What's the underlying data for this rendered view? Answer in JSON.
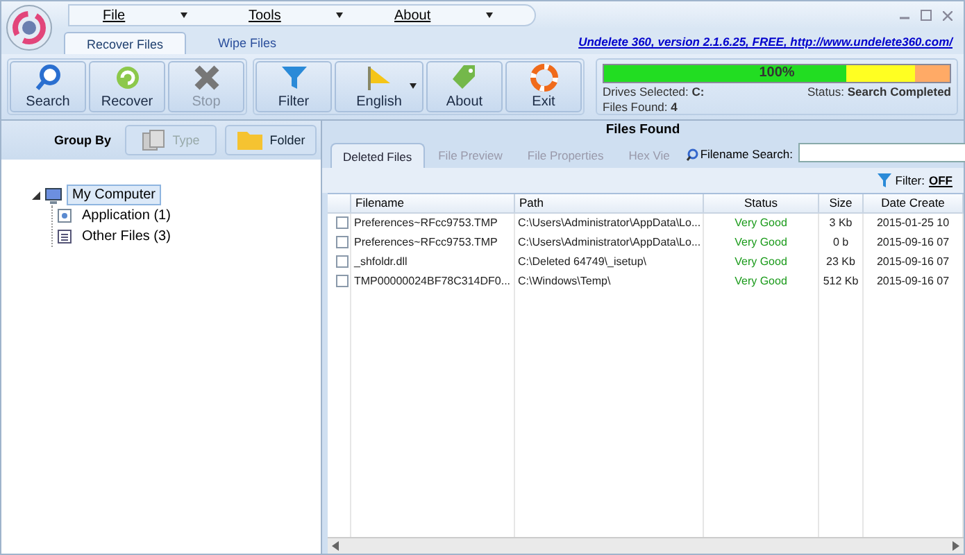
{
  "menu": [
    {
      "label": "File"
    },
    {
      "label": "Tools"
    },
    {
      "label": "About"
    }
  ],
  "ribbon_tabs": [
    {
      "label": "Recover Files",
      "selected": true
    },
    {
      "label": "Wipe Files",
      "selected": false
    }
  ],
  "version_link": "Undelete 360, version 2.1.6.25, FREE, http://www.undelete360.com/",
  "toolbar": [
    {
      "label": "Search",
      "disabled": false
    },
    {
      "label": "Recover",
      "disabled": false
    },
    {
      "label": "Stop",
      "disabled": true
    },
    {
      "label": "Filter",
      "disabled": false
    },
    {
      "label": "English",
      "disabled": false
    },
    {
      "label": "About",
      "disabled": false
    },
    {
      "label": "Exit",
      "disabled": false
    }
  ],
  "progress": {
    "level": 1.0,
    "reading": "100%"
  },
  "drives": {
    "label": "Drives Selected:",
    "value": "C:"
  },
  "files_found": {
    "label": "Files Found:",
    "value": "4"
  },
  "status": {
    "label": "Status:",
    "value": "Search Completed"
  },
  "group_by": {
    "label": "Group By",
    "buttons": [
      {
        "label": "Type",
        "disabled": true
      },
      {
        "label": "Folder",
        "disabled": false
      }
    ]
  },
  "tree": [
    {
      "label": "My Computer",
      "selected": true,
      "expanded": true,
      "children": [
        {
          "label": "Application (1)"
        },
        {
          "label": "Other Files (3)"
        }
      ]
    }
  ],
  "panel_title": "Files Found",
  "tabs": [
    {
      "label": "Deleted Files",
      "selected": true
    },
    {
      "label": "File Preview",
      "selected": false
    },
    {
      "label": "File Properties",
      "selected": false
    },
    {
      "label": "Hex Vie",
      "selected": false
    }
  ],
  "filename_search": {
    "label": "Filename Search:"
  },
  "filter": {
    "label": "Filter:",
    "value": "OFF"
  },
  "table": {
    "columns": [
      "Filename",
      "Path",
      "Status",
      "Size",
      "Date Create"
    ],
    "rows": [
      {
        "checked": false,
        "cells": [
          "Preferences~RFcc9753.TMP",
          "C:\\Users\\Administrator\\AppData\\Lo...",
          "Very Good",
          "3 Kb",
          "2015-01-25 10"
        ]
      },
      {
        "checked": false,
        "cells": [
          "Preferences~RFcc9753.TMP",
          "C:\\Users\\Administrator\\AppData\\Lo...",
          "Very Good",
          "0 b",
          "2015-09-16 07"
        ]
      },
      {
        "checked": false,
        "cells": [
          "_shfoldr.dll",
          "C:\\Deleted 64749\\_isetup\\",
          "Very Good",
          "23 Kb",
          "2015-09-16 07"
        ]
      },
      {
        "checked": false,
        "cells": [
          "TMP00000024BF78C314DF0...",
          "C:\\Windows\\Temp\\",
          "Very Good",
          "512 Kb",
          "2015-09-16 07"
        ]
      }
    ]
  }
}
